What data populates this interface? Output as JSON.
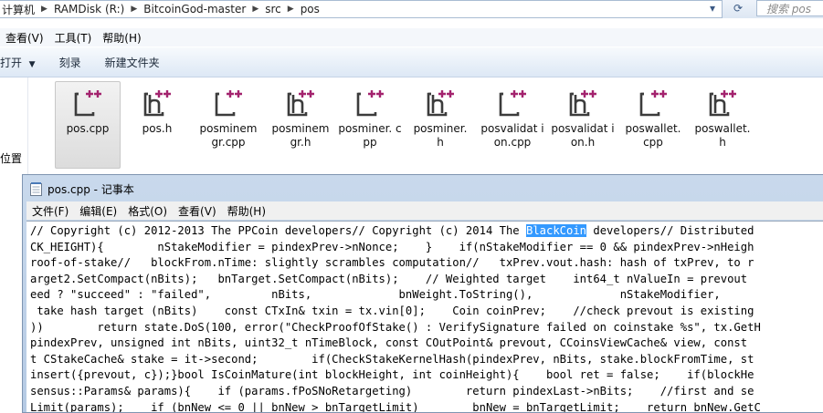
{
  "explorer": {
    "breadcrumbs": [
      "计算机",
      "RAMDisk (R:)",
      "BitcoinGod-master",
      "src",
      "pos"
    ],
    "search_placeholder": "搜索 pos",
    "menu": [
      "查看(V)",
      "工具(T)",
      "帮助(H)"
    ],
    "toolbar": [
      "打开",
      "刻录",
      "新建文件夹"
    ],
    "nav_label": "位置",
    "files": [
      {
        "name": "pos.cpp",
        "selected": true
      },
      {
        "name": "pos.h",
        "selected": false
      },
      {
        "name": "posminemgr.cpp",
        "selected": false
      },
      {
        "name": "posminemgr.h",
        "selected": false
      },
      {
        "name": "posminer.cpp",
        "selected": false
      },
      {
        "name": "posminer.h",
        "selected": false
      },
      {
        "name": "posvalidation.cpp",
        "selected": false
      },
      {
        "name": "posvalidation.h",
        "selected": false
      },
      {
        "name": "poswallet.cpp",
        "selected": false
      },
      {
        "name": "poswallet.h",
        "selected": false
      }
    ],
    "file_display_names": [
      "pos.cpp",
      "pos.h",
      "posminem gr.cpp",
      "posminem gr.h",
      "posminer. cpp",
      "posminer. h",
      "posvalidat ion.cpp",
      "posvalidat ion.h",
      "poswallet. cpp",
      "poswallet. h"
    ]
  },
  "notepad": {
    "title": "pos.cpp - 记事本",
    "menu": [
      "文件(F)",
      "编辑(E)",
      "格式(O)",
      "查看(V)",
      "帮助(H)"
    ],
    "selected_text": "BlackCoin",
    "lines": [
      {
        "pre": "// Copyright (c) 2012-2013 The PPCoin developers// Copyright (c) 2014 The ",
        "sel": "BlackCoin",
        "post": " developers// Distributed"
      },
      {
        "pre": "CK_HEIGHT){        nStakeModifier = pindexPrev->nNonce;    }    if(nStakeModifier == 0 && pindexPrev->nHeigh",
        "sel": "",
        "post": ""
      },
      {
        "pre": "roof-of-stake//   blockFrom.nTime: slightly scrambles computation//   txPrev.vout.hash: hash of txPrev, to r",
        "sel": "",
        "post": ""
      },
      {
        "pre": "arget2.SetCompact(nBits);   bnTarget.SetCompact(nBits);    // Weighted target    int64_t nValueIn = prevout",
        "sel": "",
        "post": ""
      },
      {
        "pre": "eed ? \"succeed\" : \"failed\",         nBits,             bnWeight.ToString(),             nStakeModifier,",
        "sel": "",
        "post": ""
      },
      {
        "pre": " take hash target (nBits)    const CTxIn& txin = tx.vin[0];    Coin coinPrev;    //check prevout is existing",
        "sel": "",
        "post": ""
      },
      {
        "pre": "))        return state.DoS(100, error(\"CheckProofOfStake() : VerifySignature failed on coinstake %s\", tx.GetH",
        "sel": "",
        "post": ""
      },
      {
        "pre": "pindexPrev, unsigned int nBits, uint32_t nTimeBlock, const COutPoint& prevout, CCoinsViewCache& view, const",
        "sel": "",
        "post": ""
      },
      {
        "pre": "t CStakeCache& stake = it->second;        if(CheckStakeKernelHash(pindexPrev, nBits, stake.blockFromTime, st",
        "sel": "",
        "post": ""
      },
      {
        "pre": "insert({prevout, c});}bool IsCoinMature(int blockHeight, int coinHeight){    bool ret = false;    if(blockHe",
        "sel": "",
        "post": ""
      },
      {
        "pre": "sensus::Params& params){    if (params.fPoSNoRetargeting)        return pindexLast->nBits;    //first and se",
        "sel": "",
        "post": ""
      },
      {
        "pre": "Limit(params);    if (bnNew <= 0 || bnNew > bnTargetLimit)        bnNew = bnTargetLimit;    return bnNew.GetC",
        "sel": "",
        "post": ""
      }
    ]
  },
  "colors": {
    "selection": "#3399ff",
    "icon_accent": "#a3236e",
    "icon_box": "#3c3c3c"
  }
}
